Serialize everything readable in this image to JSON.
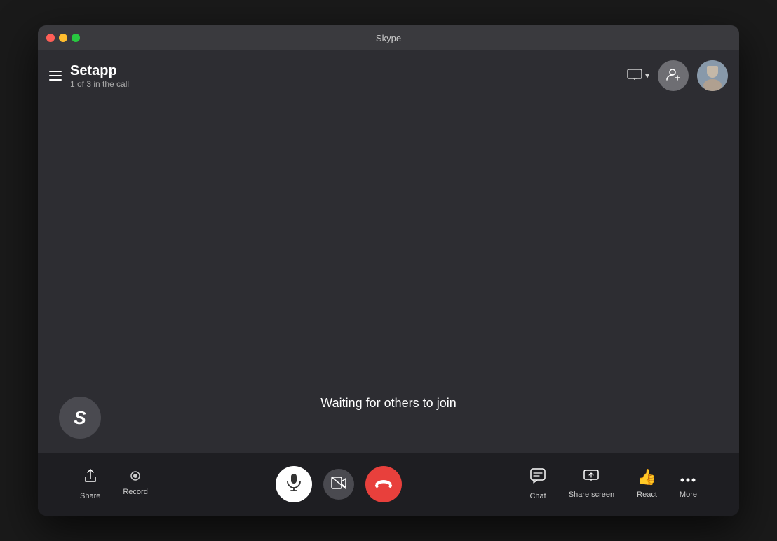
{
  "window": {
    "title": "Skype",
    "trafficLights": {
      "close": "close",
      "minimize": "minimize",
      "maximize": "maximize"
    }
  },
  "header": {
    "menuIcon": "hamburger-icon",
    "callTitle": "Setapp",
    "callSubtitle": "1 of 3 in the call",
    "screenButton": {
      "label": "",
      "icon": "screen-share-icon"
    },
    "addPersonIcon": "add-person-icon",
    "avatarIcon": "avatar-icon"
  },
  "videoArea": {
    "waitingText": "Waiting for others to join",
    "selfAvatarLetter": "S"
  },
  "toolbar": {
    "left": [
      {
        "id": "share",
        "label": "Share",
        "icon": "share-icon"
      },
      {
        "id": "record",
        "label": "Record",
        "icon": "record-icon"
      }
    ],
    "center": [
      {
        "id": "mic",
        "label": "",
        "icon": "mic-icon"
      },
      {
        "id": "video",
        "label": "",
        "icon": "video-off-icon"
      },
      {
        "id": "end-call",
        "label": "",
        "icon": "end-call-icon"
      }
    ],
    "right": [
      {
        "id": "chat",
        "label": "Chat",
        "icon": "chat-icon"
      },
      {
        "id": "share-screen",
        "label": "Share screen",
        "icon": "share-screen-icon"
      },
      {
        "id": "react",
        "label": "React",
        "icon": "react-icon"
      },
      {
        "id": "more",
        "label": "More",
        "icon": "more-icon"
      }
    ]
  }
}
